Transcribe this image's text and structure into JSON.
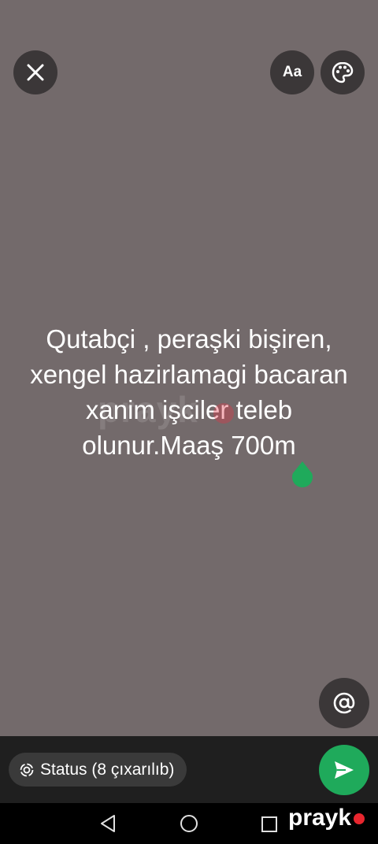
{
  "header": {
    "close_icon": "close-icon",
    "font_button_label": "Aa",
    "palette_icon": "palette-icon"
  },
  "status": {
    "text": "Qutabçi , peraşki bişiren, xengel hazirlamagi bacaran xanim işciler teleb olunur.Maaş 700m",
    "background_color": "#736a6b"
  },
  "watermark": {
    "text": "prayk"
  },
  "mention": {
    "icon": "at-icon",
    "label": "@"
  },
  "footer": {
    "audience_label": "Status (8 çıxarılıb)",
    "audience_icon": "status-ring-icon",
    "send_icon": "send-icon",
    "send_color": "#1faa5b"
  },
  "system_nav": {
    "back_icon": "back-triangle-icon",
    "home_icon": "home-circle-icon",
    "recent_icon": "recent-square-icon"
  },
  "brand": {
    "text": "prayk",
    "dot_color": "#e8262e"
  }
}
